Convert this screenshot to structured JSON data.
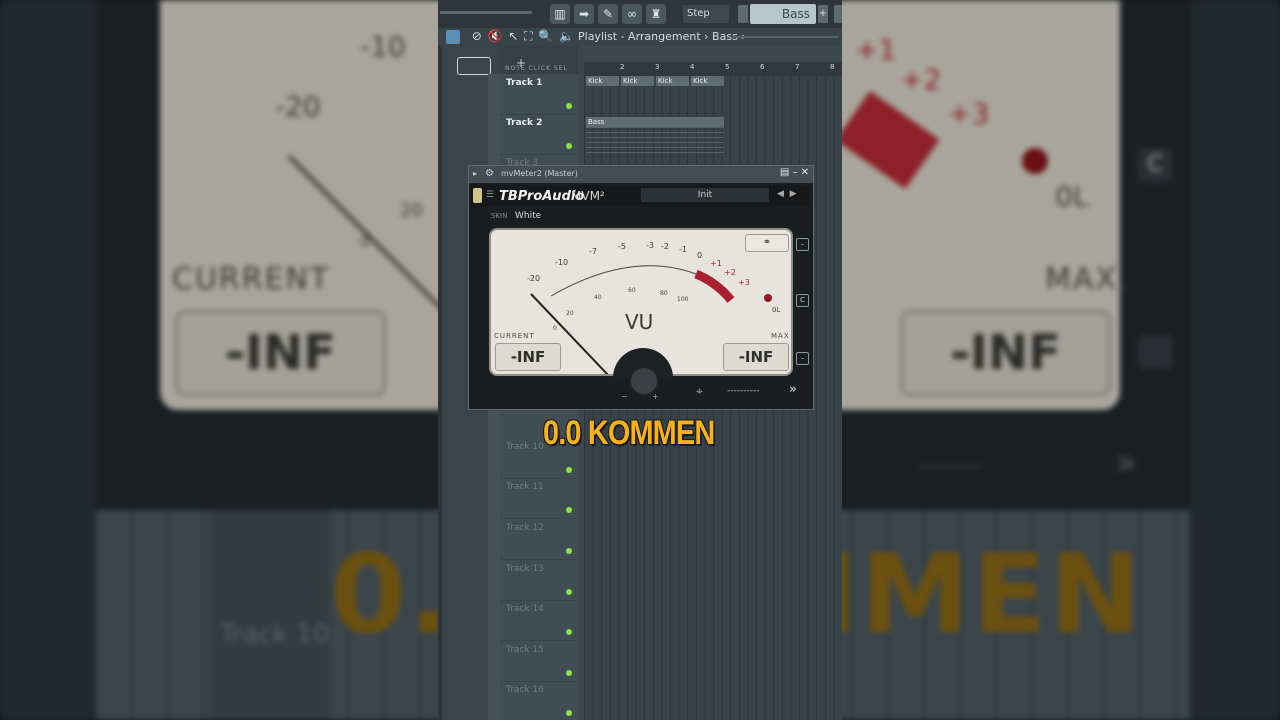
{
  "background": {
    "scale_labels": [
      "-20",
      "-10",
      "20",
      "0",
      "+1",
      "+2",
      "+3",
      "0L"
    ],
    "current_label": "CURRENT",
    "max_label": "MAX.",
    "current_value": "-INF",
    "max_value": "-INF",
    "track_label": "Track 10",
    "big_text": "0.0 KOMMEN",
    "c_button": "C"
  },
  "toolbar": {
    "step_label": "Step",
    "pattern_label": "Bass",
    "plus_label": "+"
  },
  "breadcrumb": {
    "text": "Playlist - Arrangement › Bass ›"
  },
  "track_header": {
    "plus": "+",
    "columns": "NOTE  CLICK  SEL"
  },
  "tracks": [
    {
      "name": "Track 1",
      "dim": false
    },
    {
      "name": "Track 2",
      "dim": false
    },
    {
      "name": "Track 3",
      "dim": true
    },
    {
      "name": "Track 10",
      "dim": true
    },
    {
      "name": "Track 11",
      "dim": true
    },
    {
      "name": "Track 12",
      "dim": true
    },
    {
      "name": "Track 13",
      "dim": true
    },
    {
      "name": "Track 14",
      "dim": true
    },
    {
      "name": "Track 15",
      "dim": true
    },
    {
      "name": "Track 16",
      "dim": true
    }
  ],
  "ruler": [
    "2",
    "3",
    "4",
    "5",
    "6",
    "7",
    "8"
  ],
  "clips": {
    "kick": "Kick",
    "bass": "Bass"
  },
  "plugin": {
    "title": "mvMeter2 (Master)",
    "brand": "TBProAudio",
    "product": "MVM²",
    "preset": "Init",
    "skin_label": "SKIN",
    "skin_value": "White",
    "scale_black": [
      "-20",
      "-10",
      "-7",
      "-5",
      "-3",
      "-2",
      "-1",
      "0"
    ],
    "scale_red": [
      "+1",
      "+2",
      "+3"
    ],
    "scale_small": [
      "0",
      "20",
      "40",
      "60",
      "80",
      "100"
    ],
    "vu_label": "VU",
    "current_label": "CURRENT",
    "max_label": "MAX",
    "current_value": "-INF",
    "max_value": "-INF",
    "ol_label": "0L",
    "knob_minus": "−",
    "knob_plus": "+",
    "status_dashes": "----------",
    "side_c": "C"
  },
  "overlay_text": "0.0 KOMMEN",
  "colors": {
    "overlay": "#f6b21b",
    "accent_red": "#a82030",
    "led_green": "#8fe24a"
  }
}
